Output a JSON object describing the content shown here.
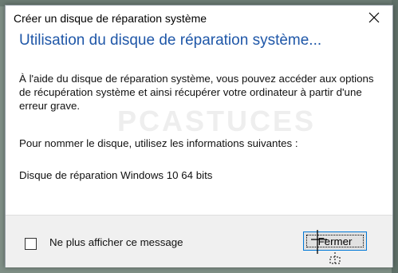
{
  "dialog": {
    "title": "Créer un disque de réparation système",
    "heading": "Utilisation du disque de réparation système...",
    "paragraph_1": "À l'aide du disque de réparation système, vous pouvez accéder aux options de récupération système et ainsi récupérer votre ordinateur à partir d'une erreur grave.",
    "paragraph_2": "Pour nommer le disque, utilisez les informations suivantes :",
    "disk_name": "Disque de réparation Windows 10 64 bits",
    "watermark": "PCASTUCES"
  },
  "footer": {
    "checkbox_label": "Ne plus afficher ce message",
    "checkbox_checked": false,
    "close_button_label": "Fermer"
  },
  "icons": {
    "close": "close-icon",
    "cursor": "move-cursor-icon"
  },
  "colors": {
    "heading": "#1f57a8",
    "button_focus_border": "#0078d7",
    "footer_bg": "#f0f0f0"
  }
}
